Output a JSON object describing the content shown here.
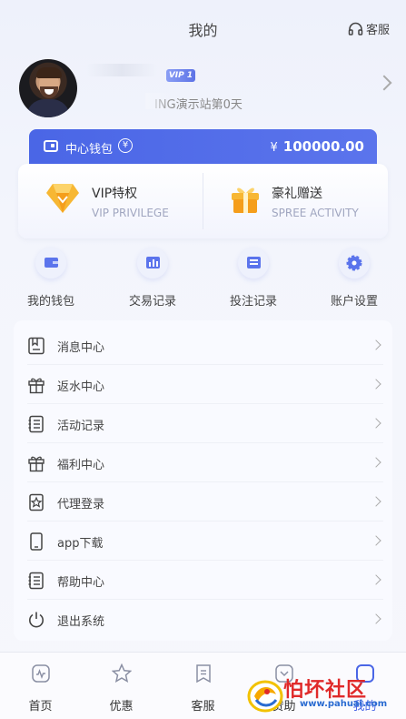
{
  "header": {
    "title": "我的",
    "service_label": "客服"
  },
  "profile": {
    "vip_level": "VIP 1",
    "days_text": "ING演示站第0天"
  },
  "wallet": {
    "label": "中心钱包",
    "currency_symbol": "¥",
    "amount": "100000.00"
  },
  "vip_cards": [
    {
      "title": "VIP特权",
      "subtitle": "VIP PRIVILEGE"
    },
    {
      "title": "豪礼赠送",
      "subtitle": "SPREE ACTIVITY"
    }
  ],
  "quick_actions": [
    {
      "label": "我的钱包",
      "icon": "wallet-icon"
    },
    {
      "label": "交易记录",
      "icon": "chart-icon"
    },
    {
      "label": "投注记录",
      "icon": "list-icon"
    },
    {
      "label": "账户设置",
      "icon": "gear-icon"
    }
  ],
  "menu": [
    {
      "label": "消息中心",
      "icon": "message-icon"
    },
    {
      "label": "返水中心",
      "icon": "gift-icon"
    },
    {
      "label": "活动记录",
      "icon": "list-icon"
    },
    {
      "label": "福利中心",
      "icon": "gift-icon"
    },
    {
      "label": "代理登录",
      "icon": "badge-icon"
    },
    {
      "label": "app下载",
      "icon": "phone-icon"
    },
    {
      "label": "帮助中心",
      "icon": "list-icon"
    },
    {
      "label": "退出系统",
      "icon": "power-icon"
    }
  ],
  "tabbar": [
    {
      "label": "首页",
      "icon": "home-icon"
    },
    {
      "label": "优惠",
      "icon": "star-icon"
    },
    {
      "label": "客服",
      "icon": "support-icon"
    },
    {
      "label": "赞助",
      "icon": "sponsor-icon"
    },
    {
      "label": "我的",
      "icon": "user-icon"
    }
  ],
  "watermark": {
    "text": "怕坏社区",
    "url": "www.pahuai.com"
  },
  "colors": {
    "primary": "#4a66e6",
    "accent_gold": "#f5a623"
  }
}
